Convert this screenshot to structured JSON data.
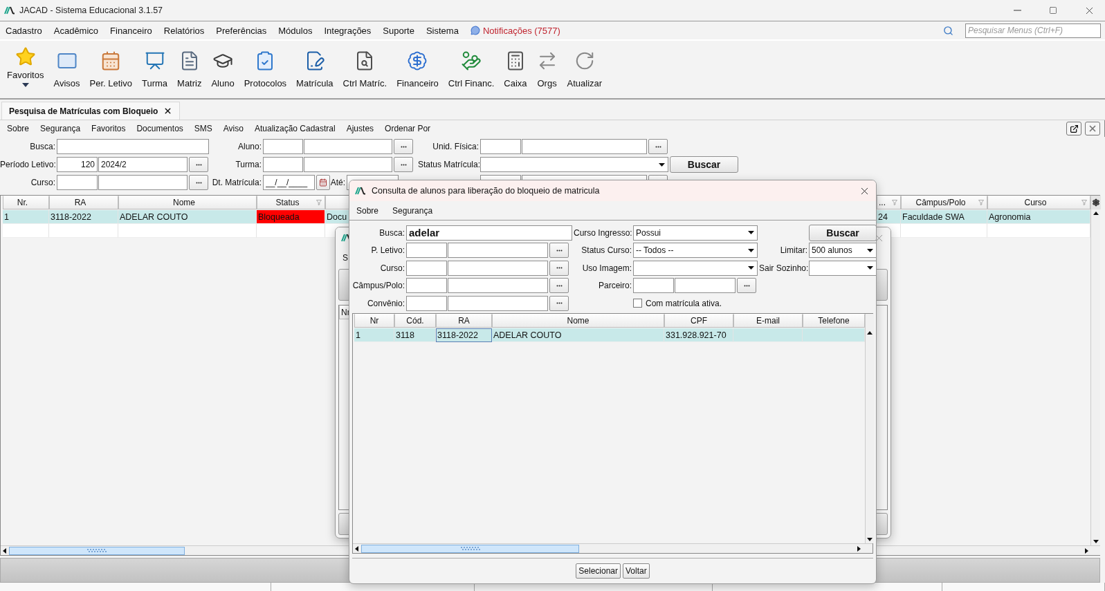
{
  "window": {
    "title": "JACAD - Sistema Educacional 3.1.57"
  },
  "menu": [
    {
      "label": "Cadastro"
    },
    {
      "label": "Acadêmico"
    },
    {
      "label": "Financeiro"
    },
    {
      "label": "Relatórios"
    },
    {
      "label": "Preferências"
    },
    {
      "label": "Módulos"
    },
    {
      "label": "Integrações"
    },
    {
      "label": "Suporte"
    },
    {
      "label": "Sistema"
    }
  ],
  "notifications": {
    "label": "Notificações (7577)"
  },
  "menu_search": {
    "placeholder": "Pesquisar Menus (Ctrl+F)"
  },
  "toolbar": [
    {
      "label": "Favoritos",
      "kind": "dropdown"
    },
    {
      "label": "Avisos",
      "kind": "button"
    },
    {
      "label": "Per. Letivo",
      "kind": "button"
    },
    {
      "label": "Turma",
      "kind": "button"
    },
    {
      "label": "Matriz",
      "kind": "button"
    },
    {
      "label": "Aluno",
      "kind": "button"
    },
    {
      "label": "Protocolos",
      "kind": "button"
    },
    {
      "label": "Matrícula",
      "kind": "button"
    },
    {
      "label": "Ctrl Matríc.",
      "kind": "button"
    },
    {
      "label": "Financeiro",
      "kind": "button"
    },
    {
      "label": "Ctrl Financ.",
      "kind": "button"
    },
    {
      "label": "Caixa",
      "kind": "button"
    },
    {
      "label": "Orgs",
      "kind": "button"
    },
    {
      "label": "Atualizar",
      "kind": "button"
    }
  ],
  "tabs": [
    {
      "label": "Pesquisa de Matrículas com Bloqueio",
      "selected": true
    }
  ],
  "submenu": [
    {
      "label": "Sobre"
    },
    {
      "label": "Segurança"
    },
    {
      "label": "Favoritos"
    },
    {
      "label": "Documentos"
    },
    {
      "label": "SMS"
    },
    {
      "label": "Aviso"
    },
    {
      "label": "Atualização Cadastral"
    },
    {
      "label": "Ajustes"
    },
    {
      "label": "Ordenar Por"
    }
  ],
  "filters": {
    "busca": {
      "label": "Busca:"
    },
    "periodo": {
      "label": "Período Letivo:",
      "code": "120",
      "value": "2024/2"
    },
    "curso": {
      "label": "Curso:"
    },
    "aluno": {
      "label": "Aluno:"
    },
    "turma": {
      "label": "Turma:"
    },
    "dt_matricula": {
      "label": "Dt. Matrícula:",
      "value": "__/__/____"
    },
    "ate": {
      "label": "Até:"
    },
    "unid_fisica": {
      "label": "Unid. Física:"
    },
    "status_matricula": {
      "label": "Status Matrícula:"
    },
    "search_button": "Buscar"
  },
  "table": {
    "columns": [
      {
        "label": "Nr.",
        "filter": false
      },
      {
        "label": "RA",
        "filter": false
      },
      {
        "label": "Nome",
        "filter": false
      },
      {
        "label": "Status",
        "filter": true
      },
      {},
      {
        "label": "...",
        "filter": true
      },
      {
        "label": "Câmpus/Polo",
        "filter": true
      },
      {
        "label": "Curso",
        "filter": true
      }
    ],
    "rows": [
      {
        "cells": [
          "1",
          "3118-2022",
          "ADELAR COUTO",
          "Bloqueada",
          "Docu",
          "24",
          "Faculdade SWA",
          "Agronomia"
        ],
        "selected": true,
        "blocked": true
      }
    ]
  },
  "back_dialog": {
    "menu": "S",
    "column": "Nr"
  },
  "dialog": {
    "title": "Consulta de alunos para liberação do bloqueio de matricula",
    "menu": [
      {
        "label": "Sobre"
      },
      {
        "label": "Segurança"
      }
    ],
    "left_fields": [
      {
        "label": "Busca:",
        "kind": "text",
        "value": "adelar"
      },
      {
        "label": "P. Letivo:",
        "kind": "lookup"
      },
      {
        "label": "Curso:",
        "kind": "lookup"
      },
      {
        "label": "Câmpus/Polo:",
        "kind": "lookup"
      },
      {
        "label": "Convênio:",
        "kind": "lookup"
      }
    ],
    "middle_fields": [
      {
        "label": "Curso Ingresso:",
        "kind": "select",
        "value": "Possui"
      },
      {
        "label": "Status Curso:",
        "kind": "select",
        "value": "-- Todos --"
      },
      {
        "label": "Uso Imagem:",
        "kind": "select"
      },
      {
        "label": "Parceiro:",
        "kind": "lookup"
      },
      {
        "label": "Com matrícula ativa.",
        "kind": "checkbox",
        "checked": false
      }
    ],
    "right_fields": [
      {
        "label": "Buscar",
        "kind": "button"
      },
      {
        "label": "Limitar:",
        "kind": "select",
        "value": "500 alunos"
      },
      {
        "label": "Sair Sozinho:",
        "kind": "select"
      }
    ],
    "columns": [
      "Nr",
      "Cód.",
      "RA",
      "Nome",
      "CPF",
      "E-mail",
      "Telefone"
    ],
    "rows": [
      {
        "selected": true,
        "cells": [
          {
            "text": "1",
            "focused": false
          },
          {
            "text": "3118",
            "focused": false
          },
          {
            "text": "3118-2022",
            "focused": true
          },
          {
            "text": "ADELAR COUTO",
            "focused": false
          },
          {
            "text": "331.928.921-70",
            "focused": false
          },
          {
            "focused": false
          },
          {
            "focused": false
          }
        ]
      }
    ],
    "buttons": [
      {
        "label": "Selecionar"
      },
      {
        "label": "Voltar"
      }
    ]
  }
}
